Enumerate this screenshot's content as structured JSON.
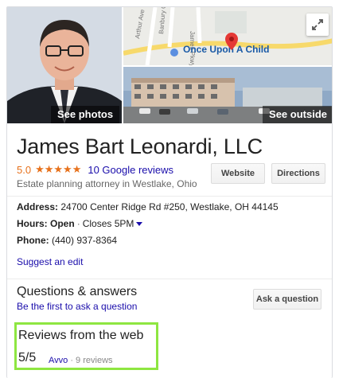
{
  "photos": {
    "see_photos_label": "See photos",
    "see_outside_label": "See outside",
    "map_place_label": "Once Upon A Child",
    "map_street_labels": [
      "Arthur Ave",
      "Banbury Ct",
      "James Pkwy"
    ]
  },
  "business": {
    "name": "James Bart Leonardi, LLC",
    "rating": "5.0",
    "stars": "★★★★★",
    "reviews_link": "10 Google reviews",
    "category": "Estate planning attorney in Westlake, Ohio"
  },
  "actions": {
    "website": "Website",
    "directions": "Directions"
  },
  "info": {
    "address_label": "Address:",
    "address_value": "24700 Center Ridge Rd #250, Westlake, OH 44145",
    "hours_label": "Hours:",
    "hours_status": "Open",
    "hours_closes": "Closes 5PM",
    "phone_label": "Phone:",
    "phone_value": "(440) 937-8364"
  },
  "suggest_edit": "Suggest an edit",
  "qa": {
    "title": "Questions & answers",
    "link": "Be the first to ask a question",
    "ask_button": "Ask a question"
  },
  "web_reviews": {
    "title": "Reviews from the web",
    "score": "5/5",
    "source": "Avvo",
    "count": "9 reviews"
  },
  "colors": {
    "star": "#e7711b",
    "link": "#1a0dab",
    "highlight": "#8ee641"
  }
}
